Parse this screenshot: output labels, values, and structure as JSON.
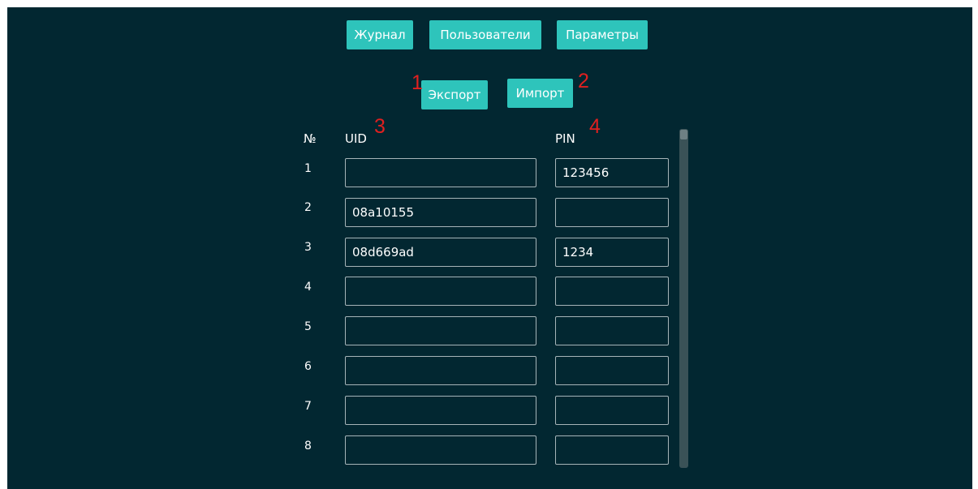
{
  "nav": {
    "journal_label": "Журнал",
    "users_label": "Пользователи",
    "params_label": "Параметры"
  },
  "actions": {
    "export_label": "Экспорт",
    "import_label": "Импорт"
  },
  "annotations": {
    "export_marker": "1",
    "import_marker": "2",
    "uid_marker": "3",
    "pin_marker": "4"
  },
  "table": {
    "headers": {
      "number": "№",
      "uid": "UID",
      "pin": "PIN"
    },
    "rows": [
      {
        "num": "1",
        "uid": "",
        "pin": "123456"
      },
      {
        "num": "2",
        "uid": "08a10155",
        "pin": ""
      },
      {
        "num": "3",
        "uid": "08d669ad",
        "pin": "1234"
      },
      {
        "num": "4",
        "uid": "",
        "pin": ""
      },
      {
        "num": "5",
        "uid": "",
        "pin": ""
      },
      {
        "num": "6",
        "uid": "",
        "pin": ""
      },
      {
        "num": "7",
        "uid": "",
        "pin": ""
      },
      {
        "num": "8",
        "uid": "",
        "pin": ""
      }
    ]
  },
  "colors": {
    "background": "#022731",
    "button": "#2ec4bb",
    "annotation": "#e02020",
    "field_border": "#a6b4b8"
  }
}
